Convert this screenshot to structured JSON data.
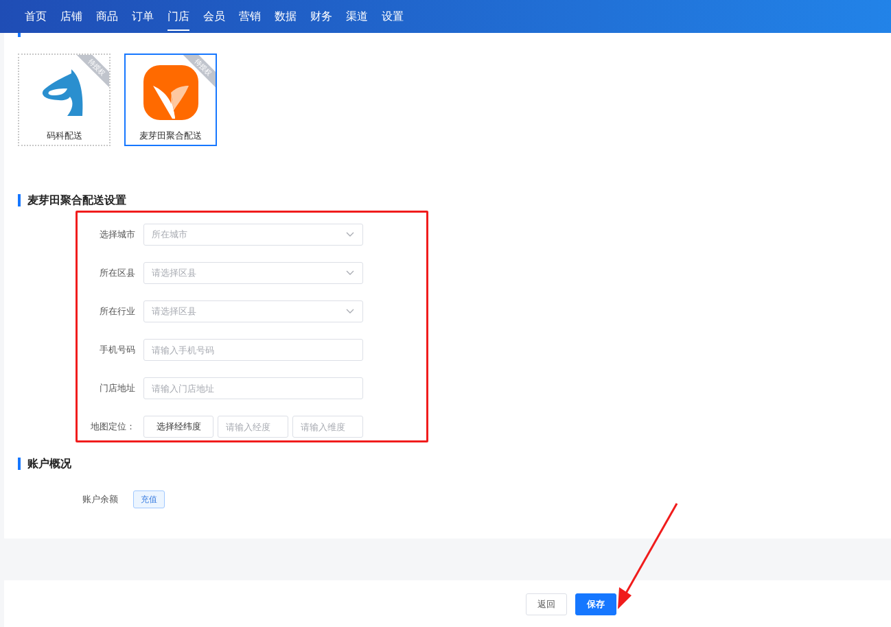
{
  "nav": {
    "items": [
      {
        "label": "首页",
        "selected": false
      },
      {
        "label": "店铺",
        "selected": false
      },
      {
        "label": "商品",
        "selected": false
      },
      {
        "label": "订单",
        "selected": false
      },
      {
        "label": "门店",
        "selected": true
      },
      {
        "label": "会员",
        "selected": false
      },
      {
        "label": "营销",
        "selected": false
      },
      {
        "label": "数据",
        "selected": false
      },
      {
        "label": "财务",
        "selected": false
      },
      {
        "label": "渠道",
        "selected": false
      },
      {
        "label": "设置",
        "selected": false
      }
    ]
  },
  "platforms": {
    "items": [
      {
        "name": "码科配送",
        "badge": "待授权",
        "selected": false,
        "kind": "horse"
      },
      {
        "name": "麦芽田聚合配送",
        "badge": "待授权",
        "selected": true,
        "kind": "sprout"
      }
    ]
  },
  "settings": {
    "title": "麦芽田聚合配送设置",
    "fields": [
      {
        "label": "选择城市",
        "kind": "select",
        "placeholder": "所在城市"
      },
      {
        "label": "所在区县",
        "kind": "select",
        "placeholder": "请选择区县"
      },
      {
        "label": "所在行业",
        "kind": "select",
        "placeholder": "请选择区县"
      },
      {
        "label": "手机号码",
        "kind": "input",
        "placeholder": "请输入手机号码"
      },
      {
        "label": "门店地址",
        "kind": "input",
        "placeholder": "请输入门店地址"
      },
      {
        "label": "地图定位：",
        "kind": "coords",
        "button": "选择经纬度",
        "inputs": [
          {
            "placeholder": "请输入经度"
          },
          {
            "placeholder": "请输入维度"
          }
        ]
      }
    ]
  },
  "account": {
    "title": "账户概况",
    "rows": [
      {
        "label": "账户余额",
        "button": "充值"
      }
    ]
  },
  "footer": {
    "buttons": [
      {
        "label": "返回",
        "kind": "secondary"
      },
      {
        "label": "保存",
        "kind": "primary"
      }
    ]
  }
}
